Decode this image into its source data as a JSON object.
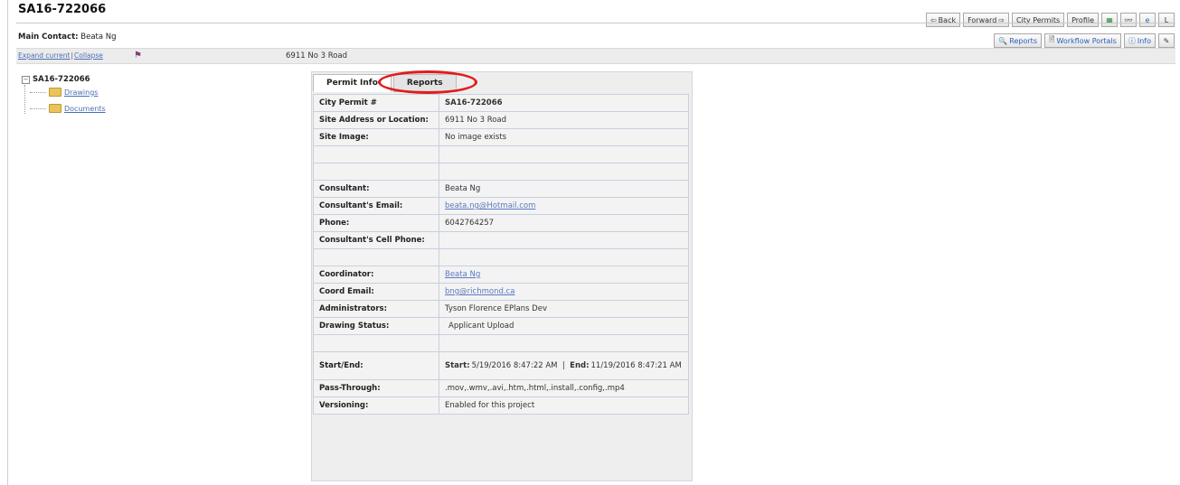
{
  "header": {
    "title": "SA16-722066",
    "main_contact_label": "Main Contact:",
    "main_contact_value": "Beata Ng",
    "expand_current": "Expand current",
    "separator": "|",
    "collapse": "Collapse",
    "address": "6911 No 3 Road"
  },
  "toolbar": {
    "back": "Back",
    "forward": "Forward",
    "city_permits": "City Permits",
    "profile": "Profile",
    "last": "L",
    "reports": "Reports",
    "workflow_portals": "Workflow Portals",
    "info": "Info"
  },
  "tree": {
    "root": "SA16-722066",
    "items": [
      "Drawings",
      "Documents"
    ]
  },
  "tabs": [
    "Permit Info",
    "Reports"
  ],
  "permit": {
    "rows": [
      {
        "label": "City Permit #",
        "value": "SA16-722066"
      },
      {
        "label": "Site Address or Location:",
        "value": "6911 No 3 Road"
      },
      {
        "label": "Site Image:",
        "value": "No image exists"
      },
      {
        "label": "",
        "value": ""
      },
      {
        "label": "",
        "value": ""
      },
      {
        "label": "Consultant:",
        "value": "Beata Ng"
      },
      {
        "label": "Consultant's Email:",
        "value": "beata.ng@Hotmail.com"
      },
      {
        "label": "Phone:",
        "value": "6042764257"
      },
      {
        "label": "Consultant's Cell Phone:",
        "value": ""
      },
      {
        "label": "",
        "value": ""
      },
      {
        "label": "Coordinator:",
        "value": "Beata Ng"
      },
      {
        "label": "Coord Email:",
        "value": "bng@richmond.ca"
      },
      {
        "label": "Administrators:",
        "value": "Tyson Florence EPlans Dev"
      },
      {
        "label": "Drawing Status:",
        "value": "Applicant Upload"
      },
      {
        "label": "",
        "value": ""
      },
      {
        "label": "Start/End:",
        "start_label": "Start:",
        "start_value": "5/19/2016 8:47:22 AM",
        "end_label": "End:",
        "end_value": "11/19/2016 8:47:21 AM"
      },
      {
        "label": "Pass-Through:",
        "value": ".mov,.wmv,.avi,.htm,.html,.install,.config,.mp4"
      },
      {
        "label": "Versioning:",
        "value": "Enabled for this project"
      }
    ]
  },
  "colors": {
    "highlight_circle": "#e21b1b",
    "link": "#5a7ac2"
  }
}
